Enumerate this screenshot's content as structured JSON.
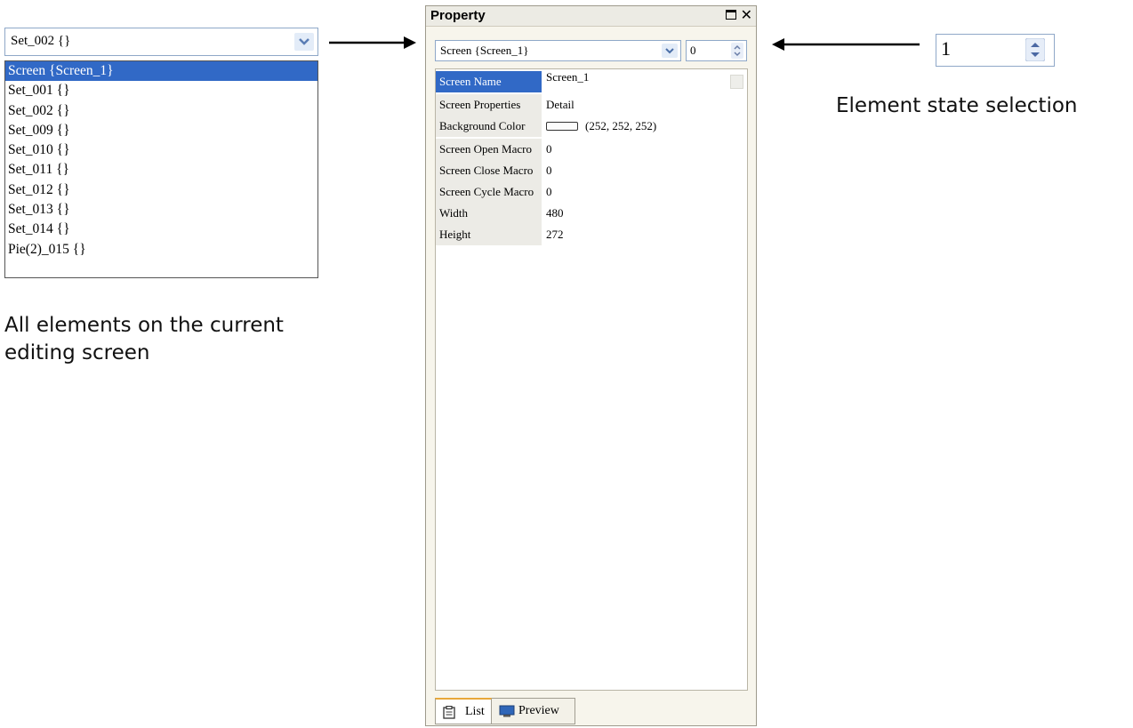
{
  "element_selector": {
    "current_value": "Set_002 {}",
    "items": [
      {
        "label": "Screen {Screen_1}",
        "selected": true
      },
      {
        "label": "Set_001 {}"
      },
      {
        "label": "Set_002 {}"
      },
      {
        "label": "Set_009 {}"
      },
      {
        "label": "Set_010 {}"
      },
      {
        "label": "Set_011 {}"
      },
      {
        "label": "Set_012 {}"
      },
      {
        "label": "Set_013 {}"
      },
      {
        "label": "Set_014 {}"
      },
      {
        "label": "Pie(2)_015 {}"
      }
    ],
    "caption": "All elements on the current editing screen"
  },
  "property_panel": {
    "title": "Property",
    "element_combo": "Screen {Screen_1}",
    "state_spinner": "0",
    "properties": [
      {
        "key": "Screen Name",
        "value": "Screen_1",
        "selected": true
      },
      {
        "key": "Screen Properties",
        "value": "Detail"
      },
      {
        "key": "Background Color",
        "value": "(252, 252, 252)",
        "swatch": "#fcfcfc"
      },
      {
        "key": "Screen Open Macro",
        "value": "0"
      },
      {
        "key": "Screen Close Macro",
        "value": "0"
      },
      {
        "key": "Screen Cycle Macro",
        "value": "0"
      },
      {
        "key": "Width",
        "value": "480"
      },
      {
        "key": "Height",
        "value": "272"
      }
    ],
    "tabs": {
      "list": "List",
      "preview": "Preview"
    }
  },
  "state_selector": {
    "value": "1",
    "caption": "Element state selection"
  },
  "colors": {
    "selection": "#3169c6",
    "panel_bg": "#f7f5ec",
    "active_tab_accent": "#e8a83a"
  }
}
